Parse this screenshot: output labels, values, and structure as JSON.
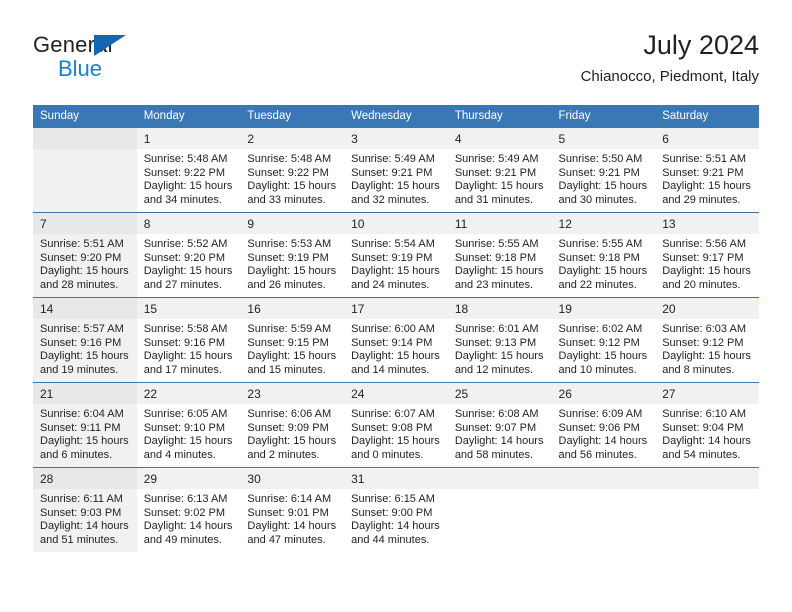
{
  "brand": {
    "name_part1": "General",
    "name_part2": "Blue",
    "flag_icon": "triangle-flag-icon",
    "color_dark": "#231f20",
    "color_blue": "#1b7fd4",
    "color_flag": "#1466b0"
  },
  "header": {
    "title": "July 2024",
    "subtitle": "Chianocco, Piedmont, Italy",
    "accent_color": "#3a78b5"
  },
  "weekday_headers": [
    "Sunday",
    "Monday",
    "Tuesday",
    "Wednesday",
    "Thursday",
    "Friday",
    "Saturday"
  ],
  "weeks": [
    [
      {
        "day": "",
        "sunrise": "",
        "sunset": "",
        "daylight1": "",
        "daylight2": ""
      },
      {
        "day": "1",
        "sunrise": "Sunrise: 5:48 AM",
        "sunset": "Sunset: 9:22 PM",
        "daylight1": "Daylight: 15 hours",
        "daylight2": "and 34 minutes."
      },
      {
        "day": "2",
        "sunrise": "Sunrise: 5:48 AM",
        "sunset": "Sunset: 9:22 PM",
        "daylight1": "Daylight: 15 hours",
        "daylight2": "and 33 minutes."
      },
      {
        "day": "3",
        "sunrise": "Sunrise: 5:49 AM",
        "sunset": "Sunset: 9:21 PM",
        "daylight1": "Daylight: 15 hours",
        "daylight2": "and 32 minutes."
      },
      {
        "day": "4",
        "sunrise": "Sunrise: 5:49 AM",
        "sunset": "Sunset: 9:21 PM",
        "daylight1": "Daylight: 15 hours",
        "daylight2": "and 31 minutes."
      },
      {
        "day": "5",
        "sunrise": "Sunrise: 5:50 AM",
        "sunset": "Sunset: 9:21 PM",
        "daylight1": "Daylight: 15 hours",
        "daylight2": "and 30 minutes."
      },
      {
        "day": "6",
        "sunrise": "Sunrise: 5:51 AM",
        "sunset": "Sunset: 9:21 PM",
        "daylight1": "Daylight: 15 hours",
        "daylight2": "and 29 minutes."
      }
    ],
    [
      {
        "day": "7",
        "sunrise": "Sunrise: 5:51 AM",
        "sunset": "Sunset: 9:20 PM",
        "daylight1": "Daylight: 15 hours",
        "daylight2": "and 28 minutes."
      },
      {
        "day": "8",
        "sunrise": "Sunrise: 5:52 AM",
        "sunset": "Sunset: 9:20 PM",
        "daylight1": "Daylight: 15 hours",
        "daylight2": "and 27 minutes."
      },
      {
        "day": "9",
        "sunrise": "Sunrise: 5:53 AM",
        "sunset": "Sunset: 9:19 PM",
        "daylight1": "Daylight: 15 hours",
        "daylight2": "and 26 minutes."
      },
      {
        "day": "10",
        "sunrise": "Sunrise: 5:54 AM",
        "sunset": "Sunset: 9:19 PM",
        "daylight1": "Daylight: 15 hours",
        "daylight2": "and 24 minutes."
      },
      {
        "day": "11",
        "sunrise": "Sunrise: 5:55 AM",
        "sunset": "Sunset: 9:18 PM",
        "daylight1": "Daylight: 15 hours",
        "daylight2": "and 23 minutes."
      },
      {
        "day": "12",
        "sunrise": "Sunrise: 5:55 AM",
        "sunset": "Sunset: 9:18 PM",
        "daylight1": "Daylight: 15 hours",
        "daylight2": "and 22 minutes."
      },
      {
        "day": "13",
        "sunrise": "Sunrise: 5:56 AM",
        "sunset": "Sunset: 9:17 PM",
        "daylight1": "Daylight: 15 hours",
        "daylight2": "and 20 minutes."
      }
    ],
    [
      {
        "day": "14",
        "sunrise": "Sunrise: 5:57 AM",
        "sunset": "Sunset: 9:16 PM",
        "daylight1": "Daylight: 15 hours",
        "daylight2": "and 19 minutes."
      },
      {
        "day": "15",
        "sunrise": "Sunrise: 5:58 AM",
        "sunset": "Sunset: 9:16 PM",
        "daylight1": "Daylight: 15 hours",
        "daylight2": "and 17 minutes."
      },
      {
        "day": "16",
        "sunrise": "Sunrise: 5:59 AM",
        "sunset": "Sunset: 9:15 PM",
        "daylight1": "Daylight: 15 hours",
        "daylight2": "and 15 minutes."
      },
      {
        "day": "17",
        "sunrise": "Sunrise: 6:00 AM",
        "sunset": "Sunset: 9:14 PM",
        "daylight1": "Daylight: 15 hours",
        "daylight2": "and 14 minutes."
      },
      {
        "day": "18",
        "sunrise": "Sunrise: 6:01 AM",
        "sunset": "Sunset: 9:13 PM",
        "daylight1": "Daylight: 15 hours",
        "daylight2": "and 12 minutes."
      },
      {
        "day": "19",
        "sunrise": "Sunrise: 6:02 AM",
        "sunset": "Sunset: 9:12 PM",
        "daylight1": "Daylight: 15 hours",
        "daylight2": "and 10 minutes."
      },
      {
        "day": "20",
        "sunrise": "Sunrise: 6:03 AM",
        "sunset": "Sunset: 9:12 PM",
        "daylight1": "Daylight: 15 hours",
        "daylight2": "and 8 minutes."
      }
    ],
    [
      {
        "day": "21",
        "sunrise": "Sunrise: 6:04 AM",
        "sunset": "Sunset: 9:11 PM",
        "daylight1": "Daylight: 15 hours",
        "daylight2": "and 6 minutes."
      },
      {
        "day": "22",
        "sunrise": "Sunrise: 6:05 AM",
        "sunset": "Sunset: 9:10 PM",
        "daylight1": "Daylight: 15 hours",
        "daylight2": "and 4 minutes."
      },
      {
        "day": "23",
        "sunrise": "Sunrise: 6:06 AM",
        "sunset": "Sunset: 9:09 PM",
        "daylight1": "Daylight: 15 hours",
        "daylight2": "and 2 minutes."
      },
      {
        "day": "24",
        "sunrise": "Sunrise: 6:07 AM",
        "sunset": "Sunset: 9:08 PM",
        "daylight1": "Daylight: 15 hours",
        "daylight2": "and 0 minutes."
      },
      {
        "day": "25",
        "sunrise": "Sunrise: 6:08 AM",
        "sunset": "Sunset: 9:07 PM",
        "daylight1": "Daylight: 14 hours",
        "daylight2": "and 58 minutes."
      },
      {
        "day": "26",
        "sunrise": "Sunrise: 6:09 AM",
        "sunset": "Sunset: 9:06 PM",
        "daylight1": "Daylight: 14 hours",
        "daylight2": "and 56 minutes."
      },
      {
        "day": "27",
        "sunrise": "Sunrise: 6:10 AM",
        "sunset": "Sunset: 9:04 PM",
        "daylight1": "Daylight: 14 hours",
        "daylight2": "and 54 minutes."
      }
    ],
    [
      {
        "day": "28",
        "sunrise": "Sunrise: 6:11 AM",
        "sunset": "Sunset: 9:03 PM",
        "daylight1": "Daylight: 14 hours",
        "daylight2": "and 51 minutes."
      },
      {
        "day": "29",
        "sunrise": "Sunrise: 6:13 AM",
        "sunset": "Sunset: 9:02 PM",
        "daylight1": "Daylight: 14 hours",
        "daylight2": "and 49 minutes."
      },
      {
        "day": "30",
        "sunrise": "Sunrise: 6:14 AM",
        "sunset": "Sunset: 9:01 PM",
        "daylight1": "Daylight: 14 hours",
        "daylight2": "and 47 minutes."
      },
      {
        "day": "31",
        "sunrise": "Sunrise: 6:15 AM",
        "sunset": "Sunset: 9:00 PM",
        "daylight1": "Daylight: 14 hours",
        "daylight2": "and 44 minutes."
      },
      {
        "day": "",
        "sunrise": "",
        "sunset": "",
        "daylight1": "",
        "daylight2": ""
      },
      {
        "day": "",
        "sunrise": "",
        "sunset": "",
        "daylight1": "",
        "daylight2": ""
      },
      {
        "day": "",
        "sunrise": "",
        "sunset": "",
        "daylight1": "",
        "daylight2": ""
      }
    ]
  ]
}
